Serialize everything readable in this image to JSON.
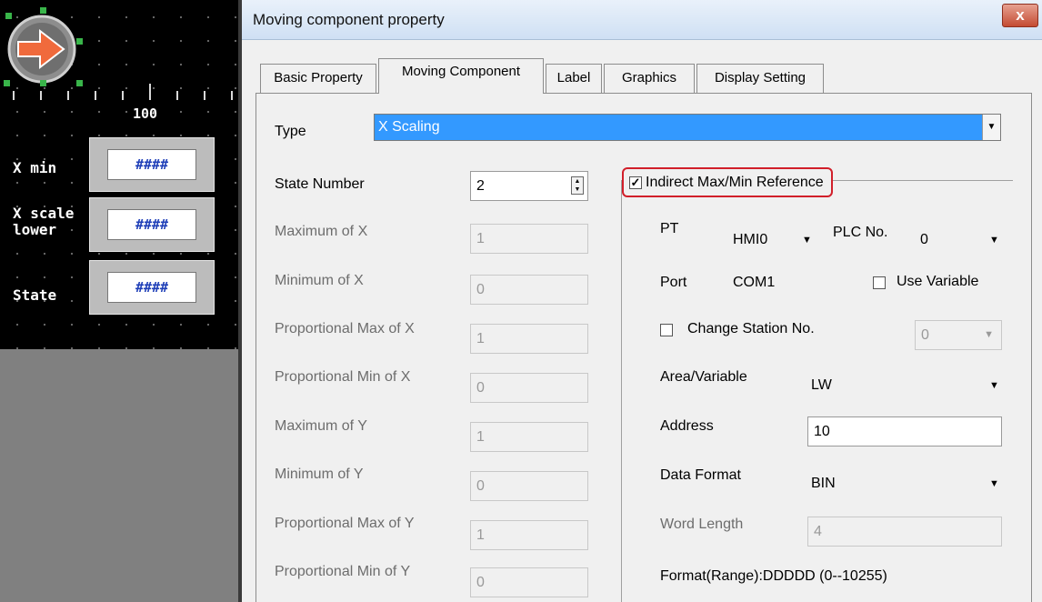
{
  "editor": {
    "ruler_value": "100",
    "rows": [
      {
        "label": "X min",
        "value": "####"
      },
      {
        "label": "X scale\nlower",
        "value": "####"
      },
      {
        "label": "State",
        "value": "####"
      }
    ]
  },
  "dialog": {
    "title": "Moving component property",
    "close": "x",
    "tabs": [
      "Basic Property",
      "Moving Component",
      "Label",
      "Graphics",
      "Display Setting"
    ],
    "active_tab": "Moving Component",
    "type_label": "Type",
    "type_value": "X Scaling",
    "fields": [
      {
        "label": "State Number",
        "value": "2",
        "enabled": true
      },
      {
        "label": "Maximum of X",
        "value": "1",
        "enabled": false
      },
      {
        "label": "Minimum of X",
        "value": "0",
        "enabled": false
      },
      {
        "label": "Proportional Max of X",
        "value": "1",
        "enabled": false
      },
      {
        "label": "Proportional Min of X",
        "value": "0",
        "enabled": false
      },
      {
        "label": "Maximum of Y",
        "value": "1",
        "enabled": false
      },
      {
        "label": "Minimum of Y",
        "value": "0",
        "enabled": false
      },
      {
        "label": "Proportional Max of Y",
        "value": "1",
        "enabled": false
      },
      {
        "label": "Proportional Min of Y",
        "value": "0",
        "enabled": false
      }
    ],
    "indirect": {
      "checkbox_label": "Indirect Max/Min Reference",
      "checked": true,
      "pt_label": "PT",
      "pt_value": "HMI0",
      "plc_label": "PLC No.",
      "plc_value": "0",
      "port_label": "Port",
      "port_value": "COM1",
      "use_variable_label": "Use Variable",
      "change_station_label": "Change Station No.",
      "station_value": "0",
      "area_label": "Area/Variable",
      "area_value": "LW",
      "address_label": "Address",
      "address_value": "10",
      "data_format_label": "Data Format",
      "data_format_value": "BIN",
      "word_length_label": "Word Length",
      "word_length_value": "4",
      "format_range": "Format(Range):DDDDD (0--10255)"
    },
    "colors": {
      "highlight": "#3399ff",
      "callout": "#d11f2a",
      "title_bar": "#dbe7f6"
    }
  }
}
